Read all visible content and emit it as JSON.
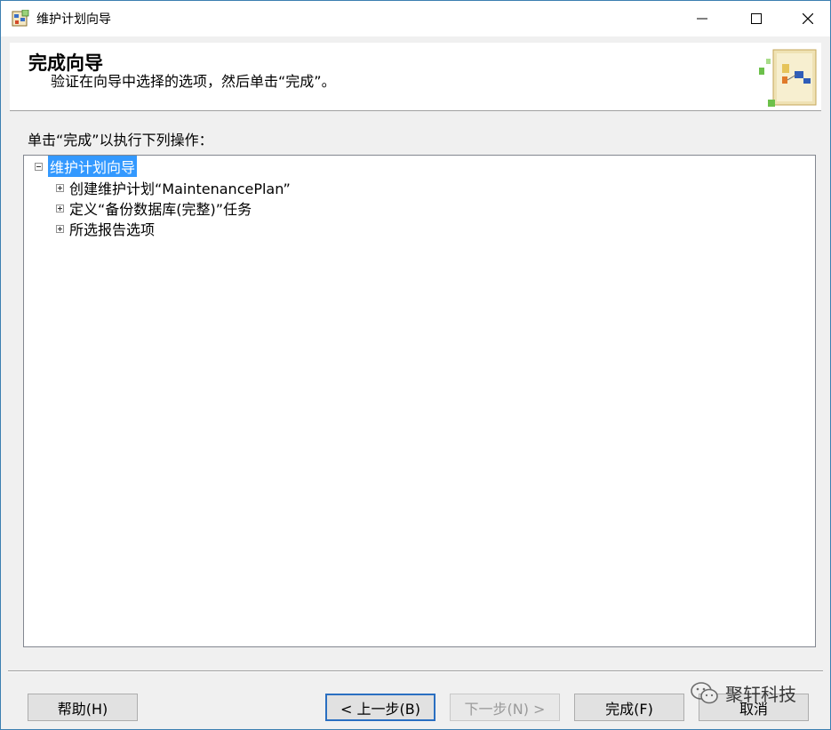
{
  "window": {
    "title": "维护计划向导"
  },
  "banner": {
    "title": "完成向导",
    "subtitle": "验证在向导中选择的选项，然后单击“完成”。"
  },
  "instruction": "单击“完成”以执行下列操作：",
  "tree": {
    "root": "维护计划向导",
    "children": [
      "创建维护计划“MaintenancePlan”",
      "定义“备份数据库(完整)”任务",
      "所选报告选项"
    ]
  },
  "buttons": {
    "help": "帮助(H)",
    "back": "< 上一步(B)",
    "next": "下一步(N) >",
    "finish": "完成(F)",
    "cancel": "取消"
  },
  "watermark": "聚轩科技",
  "colors": {
    "selection": "#3399ff",
    "default_button_border": "#2a6fc1"
  }
}
